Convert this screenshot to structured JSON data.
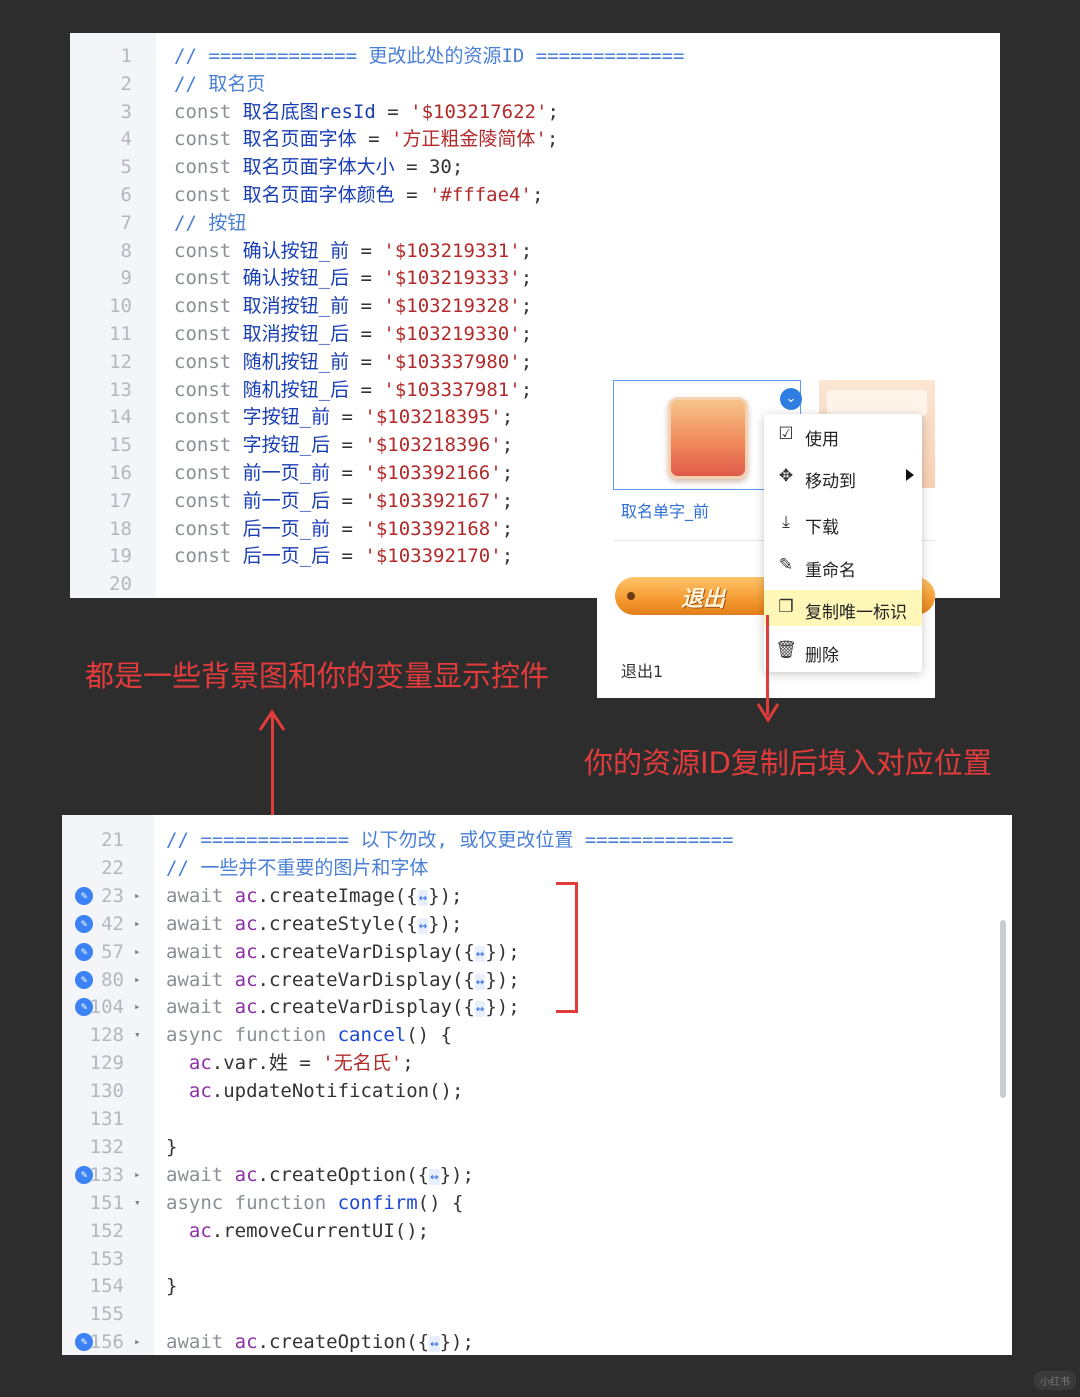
{
  "top_code": {
    "lines": [
      {
        "n": "1",
        "parts": [
          {
            "t": "// ============= 更改此处的资源ID =============",
            "c": "c-comment"
          }
        ]
      },
      {
        "n": "2",
        "parts": [
          {
            "t": "// 取名页",
            "c": "c-comment"
          }
        ]
      },
      {
        "n": "3",
        "parts": [
          {
            "t": "const ",
            "c": "c-kw"
          },
          {
            "t": "取名底图resId",
            "c": "c-var"
          },
          {
            "t": " = ",
            "c": "c-plain"
          },
          {
            "t": "'$103217622'",
            "c": "c-str"
          },
          {
            "t": ";",
            "c": "c-plain"
          }
        ]
      },
      {
        "n": "4",
        "parts": [
          {
            "t": "const ",
            "c": "c-kw"
          },
          {
            "t": "取名页面字体",
            "c": "c-var"
          },
          {
            "t": " = ",
            "c": "c-plain"
          },
          {
            "t": "'方正粗金陵简体'",
            "c": "c-str"
          },
          {
            "t": ";",
            "c": "c-plain"
          }
        ]
      },
      {
        "n": "5",
        "parts": [
          {
            "t": "const ",
            "c": "c-kw"
          },
          {
            "t": "取名页面字体大小",
            "c": "c-var"
          },
          {
            "t": " = 30;",
            "c": "c-plain"
          }
        ]
      },
      {
        "n": "6",
        "parts": [
          {
            "t": "const ",
            "c": "c-kw"
          },
          {
            "t": "取名页面字体颜色",
            "c": "c-var"
          },
          {
            "t": " = ",
            "c": "c-plain"
          },
          {
            "t": "'#fffae4'",
            "c": "c-str"
          },
          {
            "t": ";",
            "c": "c-plain"
          }
        ]
      },
      {
        "n": "7",
        "parts": [
          {
            "t": "// 按钮",
            "c": "c-comment"
          }
        ]
      },
      {
        "n": "8",
        "parts": [
          {
            "t": "const ",
            "c": "c-kw"
          },
          {
            "t": "确认按钮_前",
            "c": "c-var"
          },
          {
            "t": " = ",
            "c": "c-plain"
          },
          {
            "t": "'$103219331'",
            "c": "c-str"
          },
          {
            "t": ";",
            "c": "c-plain"
          }
        ]
      },
      {
        "n": "9",
        "parts": [
          {
            "t": "const ",
            "c": "c-kw"
          },
          {
            "t": "确认按钮_后",
            "c": "c-var"
          },
          {
            "t": " = ",
            "c": "c-plain"
          },
          {
            "t": "'$103219333'",
            "c": "c-str"
          },
          {
            "t": ";",
            "c": "c-plain"
          }
        ]
      },
      {
        "n": "10",
        "parts": [
          {
            "t": "const ",
            "c": "c-kw"
          },
          {
            "t": "取消按钮_前",
            "c": "c-var"
          },
          {
            "t": " = ",
            "c": "c-plain"
          },
          {
            "t": "'$103219328'",
            "c": "c-str"
          },
          {
            "t": ";",
            "c": "c-plain"
          }
        ]
      },
      {
        "n": "11",
        "parts": [
          {
            "t": "const ",
            "c": "c-kw"
          },
          {
            "t": "取消按钮_后",
            "c": "c-var"
          },
          {
            "t": " = ",
            "c": "c-plain"
          },
          {
            "t": "'$103219330'",
            "c": "c-str"
          },
          {
            "t": ";",
            "c": "c-plain"
          }
        ]
      },
      {
        "n": "12",
        "parts": [
          {
            "t": "const ",
            "c": "c-kw"
          },
          {
            "t": "随机按钮_前",
            "c": "c-var"
          },
          {
            "t": " = ",
            "c": "c-plain"
          },
          {
            "t": "'$103337980'",
            "c": "c-str"
          },
          {
            "t": ";",
            "c": "c-plain"
          }
        ]
      },
      {
        "n": "13",
        "parts": [
          {
            "t": "const ",
            "c": "c-kw"
          },
          {
            "t": "随机按钮_后",
            "c": "c-var"
          },
          {
            "t": " = ",
            "c": "c-plain"
          },
          {
            "t": "'$103337981'",
            "c": "c-str"
          },
          {
            "t": ";",
            "c": "c-plain"
          }
        ]
      },
      {
        "n": "14",
        "parts": [
          {
            "t": "const ",
            "c": "c-kw"
          },
          {
            "t": "字按钮_前",
            "c": "c-var"
          },
          {
            "t": " = ",
            "c": "c-plain"
          },
          {
            "t": "'$103218395'",
            "c": "c-str"
          },
          {
            "t": ";",
            "c": "c-plain"
          }
        ]
      },
      {
        "n": "15",
        "parts": [
          {
            "t": "const ",
            "c": "c-kw"
          },
          {
            "t": "字按钮_后",
            "c": "c-var"
          },
          {
            "t": " = ",
            "c": "c-plain"
          },
          {
            "t": "'$103218396'",
            "c": "c-str"
          },
          {
            "t": ";",
            "c": "c-plain"
          }
        ]
      },
      {
        "n": "16",
        "parts": [
          {
            "t": "const ",
            "c": "c-kw"
          },
          {
            "t": "前一页_前",
            "c": "c-var"
          },
          {
            "t": " = ",
            "c": "c-plain"
          },
          {
            "t": "'$103392166'",
            "c": "c-str"
          },
          {
            "t": ";",
            "c": "c-plain"
          }
        ]
      },
      {
        "n": "17",
        "parts": [
          {
            "t": "const ",
            "c": "c-kw"
          },
          {
            "t": "前一页_后",
            "c": "c-var"
          },
          {
            "t": " = ",
            "c": "c-plain"
          },
          {
            "t": "'$103392167'",
            "c": "c-str"
          },
          {
            "t": ";",
            "c": "c-plain"
          }
        ]
      },
      {
        "n": "18",
        "parts": [
          {
            "t": "const ",
            "c": "c-kw"
          },
          {
            "t": "后一页_前",
            "c": "c-var"
          },
          {
            "t": " = ",
            "c": "c-plain"
          },
          {
            "t": "'$103392168'",
            "c": "c-str"
          },
          {
            "t": ";",
            "c": "c-plain"
          }
        ]
      },
      {
        "n": "19",
        "parts": [
          {
            "t": "const ",
            "c": "c-kw"
          },
          {
            "t": "后一页_后",
            "c": "c-var"
          },
          {
            "t": " = ",
            "c": "c-plain"
          },
          {
            "t": "'$103392170'",
            "c": "c-str"
          },
          {
            "t": ";",
            "c": "c-plain"
          }
        ]
      },
      {
        "n": "20",
        "parts": []
      }
    ]
  },
  "bottom_code": {
    "lines": [
      {
        "n": "21",
        "fold": "",
        "edit": false,
        "parts": [
          {
            "t": "// ============= 以下勿改, 或仅更改位置 =============",
            "c": "c-comment"
          }
        ]
      },
      {
        "n": "22",
        "fold": "",
        "edit": false,
        "parts": [
          {
            "t": "// 一些并不重要的图片和字体",
            "c": "c-comment"
          }
        ]
      },
      {
        "n": "23",
        "fold": "▸",
        "edit": true,
        "parts": [
          {
            "t": "await ",
            "c": "c-kw"
          },
          {
            "t": "ac",
            "c": "c-ac"
          },
          {
            "t": ".createImage({",
            "c": "c-plain"
          },
          {
            "t": "↔",
            "c": "c-dots"
          },
          {
            "t": "});",
            "c": "c-plain"
          }
        ]
      },
      {
        "n": "42",
        "fold": "▸",
        "edit": true,
        "parts": [
          {
            "t": "await ",
            "c": "c-kw"
          },
          {
            "t": "ac",
            "c": "c-ac"
          },
          {
            "t": ".createStyle({",
            "c": "c-plain"
          },
          {
            "t": "↔",
            "c": "c-dots"
          },
          {
            "t": "});",
            "c": "c-plain"
          }
        ]
      },
      {
        "n": "57",
        "fold": "▸",
        "edit": true,
        "parts": [
          {
            "t": "await ",
            "c": "c-kw"
          },
          {
            "t": "ac",
            "c": "c-ac"
          },
          {
            "t": ".createVarDisplay({",
            "c": "c-plain"
          },
          {
            "t": "↔",
            "c": "c-dots"
          },
          {
            "t": "});",
            "c": "c-plain"
          }
        ]
      },
      {
        "n": "80",
        "fold": "▸",
        "edit": true,
        "parts": [
          {
            "t": "await ",
            "c": "c-kw"
          },
          {
            "t": "ac",
            "c": "c-ac"
          },
          {
            "t": ".createVarDisplay({",
            "c": "c-plain"
          },
          {
            "t": "↔",
            "c": "c-dots"
          },
          {
            "t": "});",
            "c": "c-plain"
          }
        ]
      },
      {
        "n": "104",
        "fold": "▸",
        "edit": true,
        "parts": [
          {
            "t": "await ",
            "c": "c-kw"
          },
          {
            "t": "ac",
            "c": "c-ac"
          },
          {
            "t": ".createVarDisplay({",
            "c": "c-plain"
          },
          {
            "t": "↔",
            "c": "c-dots"
          },
          {
            "t": "});",
            "c": "c-plain"
          }
        ]
      },
      {
        "n": "128",
        "fold": "▾",
        "edit": false,
        "parts": [
          {
            "t": "async function ",
            "c": "c-kw"
          },
          {
            "t": "cancel",
            "c": "c-fn"
          },
          {
            "t": "() {",
            "c": "c-plain"
          }
        ]
      },
      {
        "n": "129",
        "fold": "",
        "edit": false,
        "parts": [
          {
            "t": "  ",
            "c": "c-plain"
          },
          {
            "t": "ac",
            "c": "c-ac"
          },
          {
            "t": ".var.姓 = ",
            "c": "c-plain"
          },
          {
            "t": "'无名氏'",
            "c": "c-str"
          },
          {
            "t": ";",
            "c": "c-plain"
          }
        ]
      },
      {
        "n": "130",
        "fold": "",
        "edit": false,
        "parts": [
          {
            "t": "  ",
            "c": "c-plain"
          },
          {
            "t": "ac",
            "c": "c-ac"
          },
          {
            "t": ".updateNotification();",
            "c": "c-plain"
          }
        ]
      },
      {
        "n": "131",
        "fold": "",
        "edit": false,
        "parts": []
      },
      {
        "n": "132",
        "fold": "",
        "edit": false,
        "parts": [
          {
            "t": "}",
            "c": "c-plain"
          }
        ]
      },
      {
        "n": "133",
        "fold": "▸",
        "edit": true,
        "parts": [
          {
            "t": "await ",
            "c": "c-kw"
          },
          {
            "t": "ac",
            "c": "c-ac"
          },
          {
            "t": ".createOption({",
            "c": "c-plain"
          },
          {
            "t": "↔",
            "c": "c-dots"
          },
          {
            "t": "});",
            "c": "c-plain"
          }
        ]
      },
      {
        "n": "151",
        "fold": "▾",
        "edit": false,
        "parts": [
          {
            "t": "async function ",
            "c": "c-kw"
          },
          {
            "t": "confirm",
            "c": "c-fn"
          },
          {
            "t": "() {",
            "c": "c-plain"
          }
        ]
      },
      {
        "n": "152",
        "fold": "",
        "edit": false,
        "parts": [
          {
            "t": "  ",
            "c": "c-plain"
          },
          {
            "t": "ac",
            "c": "c-ac"
          },
          {
            "t": ".removeCurrentUI();",
            "c": "c-plain"
          }
        ]
      },
      {
        "n": "153",
        "fold": "",
        "edit": false,
        "parts": []
      },
      {
        "n": "154",
        "fold": "",
        "edit": false,
        "parts": [
          {
            "t": "}",
            "c": "c-plain"
          }
        ]
      },
      {
        "n": "155",
        "fold": "",
        "edit": false,
        "parts": []
      },
      {
        "n": "156",
        "fold": "▸",
        "edit": true,
        "parts": [
          {
            "t": "await ",
            "c": "c-kw"
          },
          {
            "t": "ac",
            "c": "c-ac"
          },
          {
            "t": ".createOption({",
            "c": "c-plain"
          },
          {
            "t": "↔",
            "c": "c-dots"
          },
          {
            "t": "});",
            "c": "c-plain"
          }
        ]
      }
    ]
  },
  "asset_panel": {
    "selected_asset_name": "取名单字_前",
    "check_icon": "chevron-down-icon",
    "exit_button_text": "退出",
    "exit_asset_name": "退出1"
  },
  "context_menu": {
    "items": [
      {
        "label": "使用",
        "icon": "checkbox-icon",
        "glyph": "☑"
      },
      {
        "label": "移动到",
        "icon": "move-icon",
        "glyph": "✥",
        "submenu": true
      },
      {
        "label": "下载",
        "icon": "download-icon",
        "glyph": "⤓"
      },
      {
        "label": "重命名",
        "icon": "pencil-icon",
        "glyph": "✎"
      },
      {
        "label": "复制唯一标识",
        "icon": "copy-icon",
        "glyph": "❐",
        "highlighted": true
      },
      {
        "label": "删除",
        "icon": "trash-icon",
        "glyph": "🗑"
      }
    ]
  },
  "annotations": {
    "left": "都是一些背景图和你的变量显示控件",
    "right": "你的资源ID复制后填入对应位置"
  },
  "watermark": "小红书",
  "colors": {
    "annotation_red": "#e23b3b",
    "accent_blue": "#2f7de1",
    "highlight_yellow": "#fff7b8"
  }
}
